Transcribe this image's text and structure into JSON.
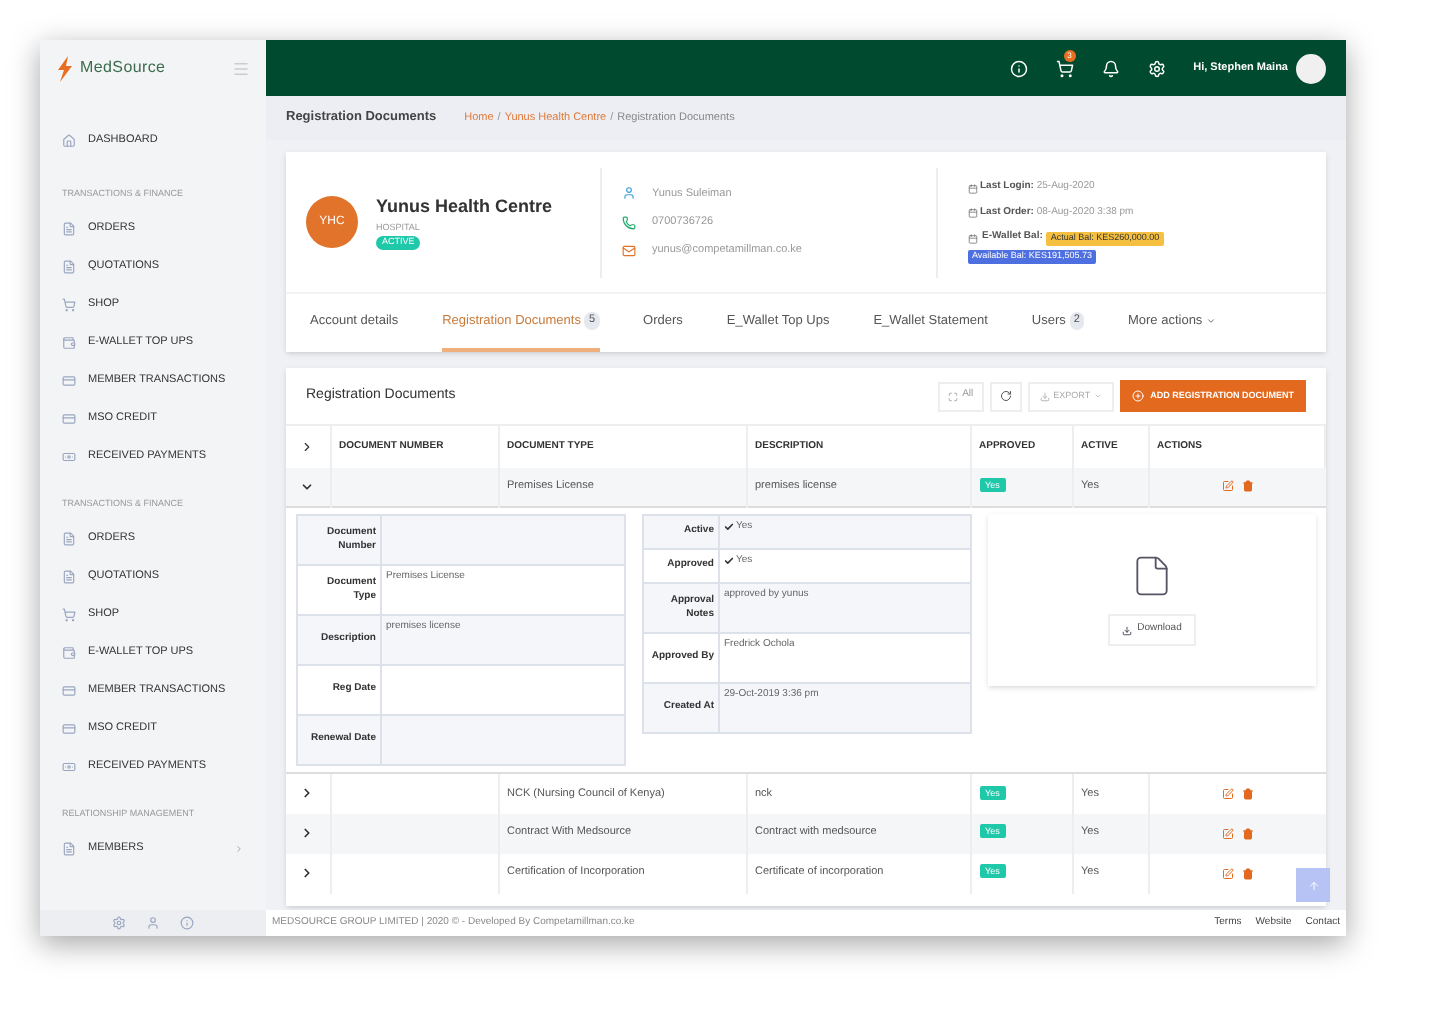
{
  "sidebar": {
    "logo": "MedSource",
    "dashboard": "DASHBOARD",
    "sections": [
      {
        "title": "TRANSACTIONS & FINANCE",
        "items": [
          {
            "label": "ORDERS"
          },
          {
            "label": "QUOTATIONS"
          },
          {
            "label": "SHOP"
          },
          {
            "label": "E-WALLET TOP UPS"
          },
          {
            "label": "MEMBER TRANSACTIONS"
          },
          {
            "label": "MSO CREDIT"
          },
          {
            "label": "RECEIVED PAYMENTS"
          }
        ]
      },
      {
        "title": "TRANSACTIONS & FINANCE",
        "items": [
          {
            "label": "ORDERS"
          },
          {
            "label": "QUOTATIONS"
          },
          {
            "label": "SHOP"
          },
          {
            "label": "E-WALLET TOP UPS"
          },
          {
            "label": "MEMBER TRANSACTIONS"
          },
          {
            "label": "MSO CREDIT"
          },
          {
            "label": "RECEIVED PAYMENTS"
          }
        ]
      },
      {
        "title": "RELATIONSHIP MANAGEMENT",
        "items": [
          {
            "label": "MEMBERS",
            "expandable": true
          }
        ]
      }
    ]
  },
  "topbar": {
    "cart_badge": "3",
    "greeting": "Hi, Stephen Maina"
  },
  "page_header": {
    "title": "Registration Documents",
    "breadcrumbs": [
      {
        "label": "Home",
        "kind": "link"
      },
      {
        "label": "/",
        "kind": "separator"
      },
      {
        "label": "Yunus Health Centre",
        "kind": "link"
      },
      {
        "label": "/",
        "kind": "separator"
      },
      {
        "label": "Registration Documents",
        "kind": "current"
      }
    ]
  },
  "profile": {
    "initials": "YHC",
    "name": "Yunus Health Centre",
    "type": "HOSPITAL",
    "status": "ACTIVE",
    "contact": "Yunus Suleiman",
    "phone": "0700736726",
    "email": "yunus@competamillman.co.ke",
    "last_login": {
      "label": "Last Login:",
      "value": "25-Aug-2020"
    },
    "last_order": {
      "label": "Last Order:",
      "value": "08-Aug-2020 3:38 pm"
    },
    "wallet": {
      "label": "E-Wallet Bal:",
      "actual": "Actual Bal: KES260,000.00",
      "available": "Available Bal: KES191,505.73"
    }
  },
  "tabs": [
    {
      "label": "Account details",
      "selected": false
    },
    {
      "label": "Registration Documents",
      "count": "5",
      "selected": true
    },
    {
      "label": "Orders",
      "selected": false
    },
    {
      "label": "E_Wallet Top Ups",
      "selected": false
    },
    {
      "label": "E_Wallet Statement",
      "selected": false
    },
    {
      "label": "Users",
      "count": "2",
      "selected": false
    },
    {
      "label": "More actions",
      "kind": "menu",
      "selected": false
    }
  ],
  "documents": {
    "title": "Registration Documents",
    "toolbar": {
      "all": "All",
      "export": "EXPORT",
      "add": "ADD REGISTRATION DOCUMENT"
    },
    "columns": [
      "DOCUMENT NUMBER",
      "DOCUMENT TYPE",
      "DESCRIPTION",
      "APPROVED",
      "ACTIVE",
      "ACTIONS"
    ],
    "rows": [
      {
        "type": "Premises License",
        "description": "premises license",
        "approved": "Yes",
        "active": "Yes",
        "expanded": true,
        "details": {
          "left": [
            {
              "label": "Document Number"
            },
            {
              "label": "Document Type",
              "value": "Premises License"
            },
            {
              "label": "Description",
              "value": "premises license"
            },
            {
              "label": "Reg Date"
            },
            {
              "label": "Renewal Date"
            }
          ],
          "right": [
            {
              "label": "Active",
              "value": "Yes",
              "kind": "check"
            },
            {
              "label": "Approved",
              "value": "Yes",
              "kind": "check"
            },
            {
              "label": "Approval Notes",
              "value": "approved by yunus",
              "kind": "text"
            },
            {
              "label": "Approved By",
              "value": "Fredrick Ochola",
              "kind": "text"
            },
            {
              "label": "Created At",
              "value": "29-Oct-2019 3:36 pm",
              "kind": "text"
            }
          ],
          "download": "Download"
        }
      },
      {
        "type": "NCK (Nursing Council of Kenya)",
        "description": "nck",
        "approved": "Yes",
        "active": "Yes",
        "expanded": false
      },
      {
        "type": "Contract With Medsource",
        "description": "Contract with medsource",
        "approved": "Yes",
        "active": "Yes",
        "expanded": false
      },
      {
        "type": "Certification of Incorporation",
        "description": "Certificate of incorporation",
        "approved": "Yes",
        "active": "Yes",
        "expanded": false
      }
    ]
  },
  "footer": {
    "copyright": "MEDSOURCE GROUP LIMITED | 2020 © - Developed By Competamillman.co.ke",
    "links": [
      "Terms",
      "Website",
      "Contact"
    ]
  }
}
